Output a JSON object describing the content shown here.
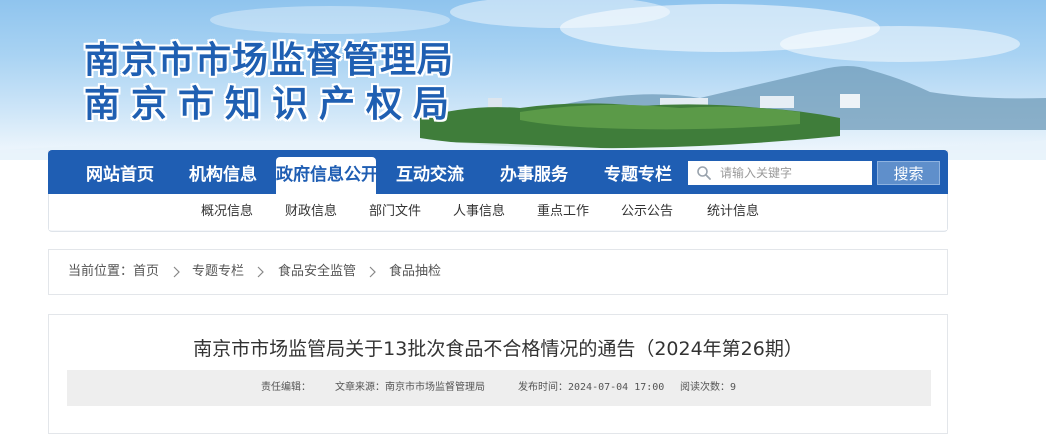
{
  "banner": {
    "title_line1": "南京市市场监督管理局",
    "title_line2": "南京市知识产权局"
  },
  "nav": {
    "items": [
      {
        "label": "网站首页"
      },
      {
        "label": "机构信息"
      },
      {
        "label": "政府信息公开",
        "active": true
      },
      {
        "label": "互动交流"
      },
      {
        "label": "办事服务"
      },
      {
        "label": "专题专栏"
      }
    ],
    "search_placeholder": "请输入关键字",
    "search_value": "",
    "search_button": "搜索"
  },
  "sub_nav": {
    "items": [
      {
        "label": "概况信息"
      },
      {
        "label": "财政信息"
      },
      {
        "label": "部门文件"
      },
      {
        "label": "人事信息"
      },
      {
        "label": "重点工作"
      },
      {
        "label": "公示公告"
      },
      {
        "label": "统计信息"
      }
    ]
  },
  "breadcrumb": {
    "prefix": "当前位置：",
    "items": [
      {
        "label": "首页"
      },
      {
        "label": "专题专栏"
      },
      {
        "label": "食品安全监管"
      },
      {
        "label": "食品抽检"
      }
    ]
  },
  "article": {
    "title": "南京市市场监管局关于13批次食品不合格情况的通告（2024年第26期）",
    "editor": "责任编辑：",
    "source": "文章来源：南京市市场监督管理局",
    "published": "发布时间：2024-07-04 17:00",
    "views": "阅读次数：9"
  },
  "colors": {
    "nav_blue": "#1f5eb3",
    "title_blue": "#1f5fb2",
    "search_button": "#5f8fcb"
  },
  "icons": {
    "search": "search-icon",
    "breadcrumb_separator": "chevron-right-icon"
  }
}
